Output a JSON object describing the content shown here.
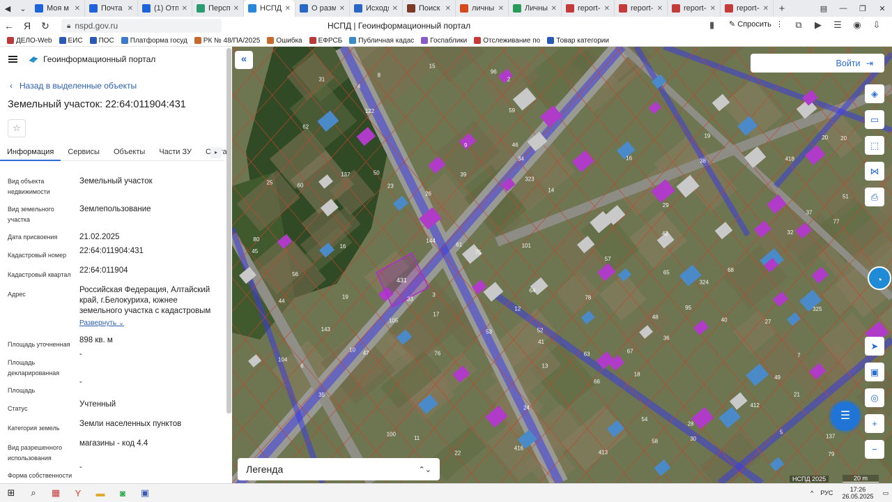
{
  "browser": {
    "tabs": [
      {
        "label": "Моя м",
        "color": "#1e63d8",
        "active": false
      },
      {
        "label": "Почта Mail",
        "color": "#1e63d8",
        "active": false
      },
      {
        "label": "(1) Отправ",
        "color": "#1e63d8",
        "active": false
      },
      {
        "label": "Перспекти",
        "color": "#2e9a72",
        "active": false
      },
      {
        "label": "НСПД | Г",
        "color": "#2b88d8",
        "active": true
      },
      {
        "label": "О размеще",
        "color": "#2a66c4",
        "active": false
      },
      {
        "label": "Исходящи",
        "color": "#2a66c4",
        "active": false
      },
      {
        "label": "Поиск доку",
        "color": "#7a3b26",
        "active": false
      },
      {
        "label": "личный ка",
        "color": "#d64b1c",
        "active": false
      },
      {
        "label": "Личный ка",
        "color": "#2a9a5a",
        "active": false
      },
      {
        "label": "report-b1b",
        "color": "#c43b3b",
        "active": false
      },
      {
        "label": "report-bf7",
        "color": "#c43b3b",
        "active": false
      },
      {
        "label": "report-cce",
        "color": "#c43b3b",
        "active": false
      },
      {
        "label": "report-dfd",
        "color": "#c43b3b",
        "active": false
      }
    ],
    "url": "nspd.gov.ru",
    "page_title": "НСПД | Геоинформационный портал",
    "ask_label": "Спросить",
    "bookmarks": [
      {
        "label": "ДЕЛО-Web",
        "color": "#b83a3a"
      },
      {
        "label": "ЕИС",
        "color": "#2a5ab8"
      },
      {
        "label": "ПОС",
        "color": "#2a5ab8"
      },
      {
        "label": "Платформа госуд",
        "color": "#3a7ac8"
      },
      {
        "label": "РК № 48/ПА/2025",
        "color": "#c8682a"
      },
      {
        "label": "Ошибка",
        "color": "#c8682a"
      },
      {
        "label": "ЕФРСБ",
        "color": "#b83a3a"
      },
      {
        "label": "Публичная кадас",
        "color": "#3a8ac8"
      },
      {
        "label": "Госпаблики",
        "color": "#8a5ac8"
      },
      {
        "label": "Отслеживание по",
        "color": "#c83a3a"
      },
      {
        "label": "Товар категории",
        "color": "#2a5ab8"
      }
    ]
  },
  "panel": {
    "portal_title": "Геоинформационный портал",
    "back_label": "Назад в выделенные объекты",
    "object_title": "Земельный участок: 22:64:011904:431",
    "tabs": [
      "Информация",
      "Сервисы",
      "Объекты",
      "Части ЗУ",
      "Соста"
    ],
    "properties": [
      {
        "label": "Вид объекта недвижимости",
        "value": "Земельный участок"
      },
      {
        "label": "Вид земельного участка",
        "value": "Землепользование"
      },
      {
        "label": "Дата присвоения",
        "value": "21.02.2025"
      },
      {
        "label": "Кадастровый номер",
        "value": "22:64:011904:431"
      },
      {
        "label": "Кадастровый квартал",
        "value": "22:64:011904"
      },
      {
        "label": "Адрес",
        "value": "Российская Федерация, Алтайский край, г.Белокуриха, южнее земельного участка с кадастровым"
      },
      {
        "label": "Площадь уточненная",
        "value": "898 кв. м"
      },
      {
        "label": "Площадь декларированная",
        "value": "-"
      },
      {
        "label": "Площадь",
        "value": "-"
      },
      {
        "label": "Статус",
        "value": "Учтенный"
      },
      {
        "label": "Категория земель",
        "value": "Земли населенных пунктов"
      },
      {
        "label": "Вид разрешенного использования",
        "value": "магазины - код 4.4"
      },
      {
        "label": "Форма собственности",
        "value": "-"
      }
    ],
    "expand_label": "Развернуть"
  },
  "map": {
    "login_label": "Войти",
    "legend_label": "Легенда",
    "copyright": "НСПД 2025",
    "scale_label": "20 m",
    "selected_parcel_label": "431",
    "parcel_labels": [
      "16",
      "15",
      "14",
      "19",
      "13",
      "20",
      "34",
      "418",
      "416",
      "413",
      "412",
      "100",
      "52",
      "54",
      "42",
      "41",
      "36",
      "35",
      "37",
      "33",
      "32",
      "31",
      "30",
      "3",
      "2",
      "96",
      "95",
      "10",
      "16",
      "24",
      "29",
      "28",
      "27",
      "26",
      "25",
      "23",
      "22",
      "21",
      "20",
      "19",
      "18",
      "17",
      "56",
      "57",
      "58",
      "59",
      "60",
      "61",
      "63",
      "64",
      "65",
      "40",
      "44",
      "45",
      "46",
      "47",
      "48",
      "49",
      "50",
      "51",
      "53",
      "12",
      "11",
      "9",
      "8",
      "7",
      "6",
      "5",
      "4",
      "325",
      "324",
      "323",
      "122",
      "137",
      "104",
      "105",
      "101",
      "76",
      "75",
      "77",
      "78",
      "79",
      "80",
      "143",
      "144",
      "137",
      "39",
      "38",
      "62",
      "66",
      "67",
      "68"
    ]
  },
  "taskbar": {
    "lang": "РУС",
    "time": "17:26",
    "date": "26.05.2025"
  }
}
